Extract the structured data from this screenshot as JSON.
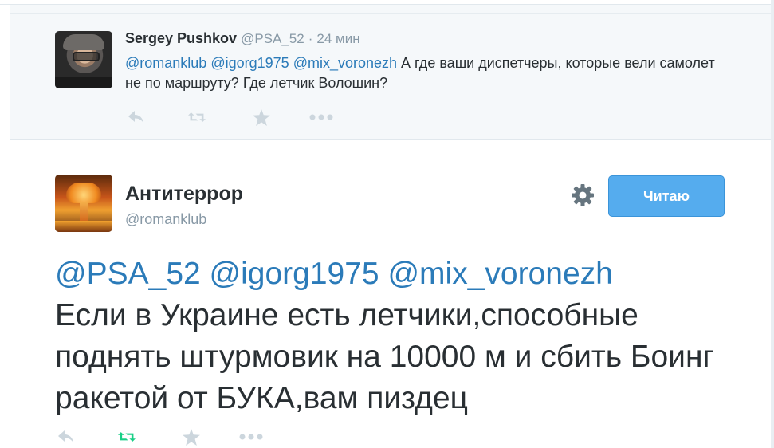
{
  "reply_tweet": {
    "author_name": "Sergey Pushkov",
    "author_handle": "@PSA_52",
    "separator": "·",
    "time": "24 мин",
    "mentions": [
      "@romanklub",
      "@igorg1975",
      "@mix_voronezh"
    ],
    "text": "А где ваши диспетчеры, которые вели самолет не по маршруту? Где летчик Волошин?"
  },
  "main_tweet": {
    "author_name": "Антитеррор",
    "author_handle": "@romanklub",
    "follow_button_label": "Читаю",
    "mentions": [
      "@PSA_52",
      "@igorg1975",
      "@mix_voronezh"
    ],
    "text": "Если в Украине есть летчики,способные поднять штурмовик на 10000 м и сбить Боинг ракетой от БУКА,вам пиздец"
  },
  "icons": {
    "reply": "reply-icon",
    "retweet": "retweet-icon",
    "favorite": "star-icon",
    "more": "more-icon",
    "settings": "gear-icon"
  },
  "colors": {
    "link": "#2b7bb9",
    "muted": "#8899a6",
    "icon": "#ccd6dd",
    "retweet_active": "#19cf86",
    "follow_button": "#55acee",
    "panel_bg": "#f5f8fa"
  }
}
